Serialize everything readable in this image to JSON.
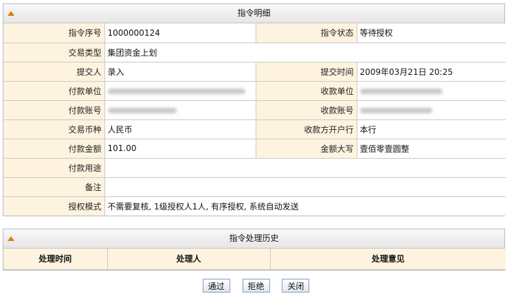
{
  "detail": {
    "title": "指令明细",
    "rows": [
      {
        "l1": "指令序号",
        "v1": "1000000124",
        "l2": "指令状态",
        "v2": "等待授权"
      },
      {
        "l1": "交易类型",
        "v1": "集团资金上划"
      },
      {
        "l1": "提交人",
        "v1": "录入",
        "l2": "提交时间",
        "v2": "2009年03月21日 20:25"
      },
      {
        "l1": "付款单位",
        "l2": "收款单位"
      },
      {
        "l1": "付款账号",
        "l2": "收款账号"
      },
      {
        "l1": "交易币种",
        "v1": "人民币",
        "l2": "收款方开户行",
        "v2": "本行"
      },
      {
        "l1": "付款金额",
        "v1": "101.00",
        "l2": "金额大写",
        "v2": "壹佰零壹圆整"
      },
      {
        "l1": "付款用途",
        "v1": ""
      },
      {
        "l1": "备注",
        "v1": ""
      },
      {
        "l1": "授权模式",
        "v1": "不需要复核, 1级授权人1人, 有序授权, 系统自动发送"
      }
    ]
  },
  "history": {
    "title": "指令处理历史",
    "columns": [
      "处理时间",
      "处理人",
      "处理意见"
    ]
  },
  "buttons": {
    "approve": "通过",
    "reject": "拒绝",
    "close": "关闭"
  },
  "colors": {
    "label_bg": "#fdf3df",
    "accent_triangle": "#e07a10",
    "border": "#c9c9c9"
  }
}
